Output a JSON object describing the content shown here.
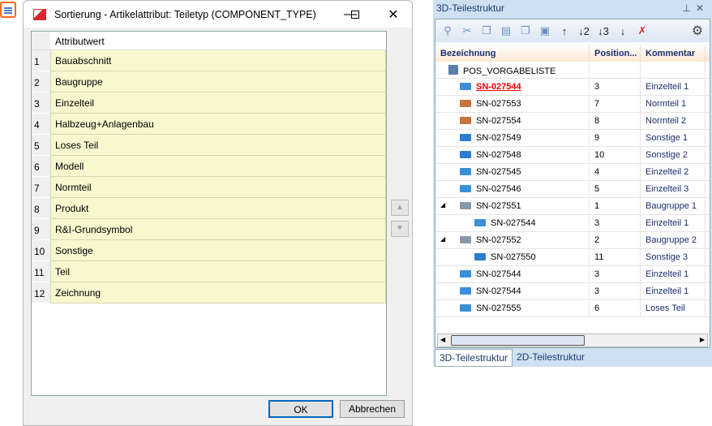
{
  "dialog": {
    "title": "Sortierung - Artikelattribut: Teiletyp (COMPONENT_TYPE)",
    "column_header": "Attributwert",
    "rows": [
      {
        "n": "1",
        "v": "Bauabschnitt"
      },
      {
        "n": "2",
        "v": "Baugruppe"
      },
      {
        "n": "3",
        "v": "Einzelteil"
      },
      {
        "n": "4",
        "v": "Halbzeug+Anlagenbau"
      },
      {
        "n": "5",
        "v": "Loses Teil"
      },
      {
        "n": "6",
        "v": "Modell"
      },
      {
        "n": "7",
        "v": "Normteil"
      },
      {
        "n": "8",
        "v": "Produkt"
      },
      {
        "n": "9",
        "v": "R&I-Grundsymbol"
      },
      {
        "n": "10",
        "v": "Sonstige"
      },
      {
        "n": "11",
        "v": "Teil"
      },
      {
        "n": "12",
        "v": "Zeichnung"
      }
    ],
    "ok": "OK",
    "cancel": "Abbrechen"
  },
  "panel": {
    "title": "3D-Teilestruktur",
    "columns": [
      "Bezeichnung",
      "Position...",
      "Kommentar"
    ],
    "root": "POS_VORGABELISTE",
    "rows": [
      {
        "name": "SN-027544",
        "pos": "3",
        "comment": "Einzelteil 1",
        "level": 1,
        "type": "part"
      },
      {
        "name": "SN-027553",
        "pos": "7",
        "comment": "Normteil 1",
        "level": 1,
        "type": "norm"
      },
      {
        "name": "SN-027554",
        "pos": "8",
        "comment": "Normteil 2",
        "level": 1,
        "type": "norm"
      },
      {
        "name": "SN-027549",
        "pos": "9",
        "comment": "Sonstige 1",
        "level": 1,
        "type": "beam"
      },
      {
        "name": "SN-027548",
        "pos": "10",
        "comment": "Sonstige 2",
        "level": 1,
        "type": "beam"
      },
      {
        "name": "SN-027545",
        "pos": "4",
        "comment": "Einzelteil 2",
        "level": 1,
        "type": "part"
      },
      {
        "name": "SN-027546",
        "pos": "5",
        "comment": "Einzelteil 3",
        "level": 1,
        "type": "part"
      },
      {
        "name": "SN-027551",
        "pos": "1",
        "comment": "Baugruppe 1",
        "level": 1,
        "type": "assembly"
      },
      {
        "name": "SN-027544",
        "pos": "3",
        "comment": "Einzelteil 1",
        "level": 2,
        "type": "part"
      },
      {
        "name": "SN-027552",
        "pos": "2",
        "comment": "Baugruppe 2",
        "level": 1,
        "type": "assembly"
      },
      {
        "name": "SN-027550",
        "pos": "11",
        "comment": "Sonstige 3",
        "level": 2,
        "type": "beam"
      },
      {
        "name": "SN-027544",
        "pos": "3",
        "comment": "Einzelteil 1",
        "level": 1,
        "type": "part"
      },
      {
        "name": "SN-027544",
        "pos": "3",
        "comment": "Einzelteil 1",
        "level": 1,
        "type": "part"
      },
      {
        "name": "SN-027555",
        "pos": "6",
        "comment": "Loses Teil",
        "level": 1,
        "type": "part"
      }
    ],
    "tabs": [
      "3D-Teilestruktur",
      "2D-Teilestruktur"
    ]
  }
}
